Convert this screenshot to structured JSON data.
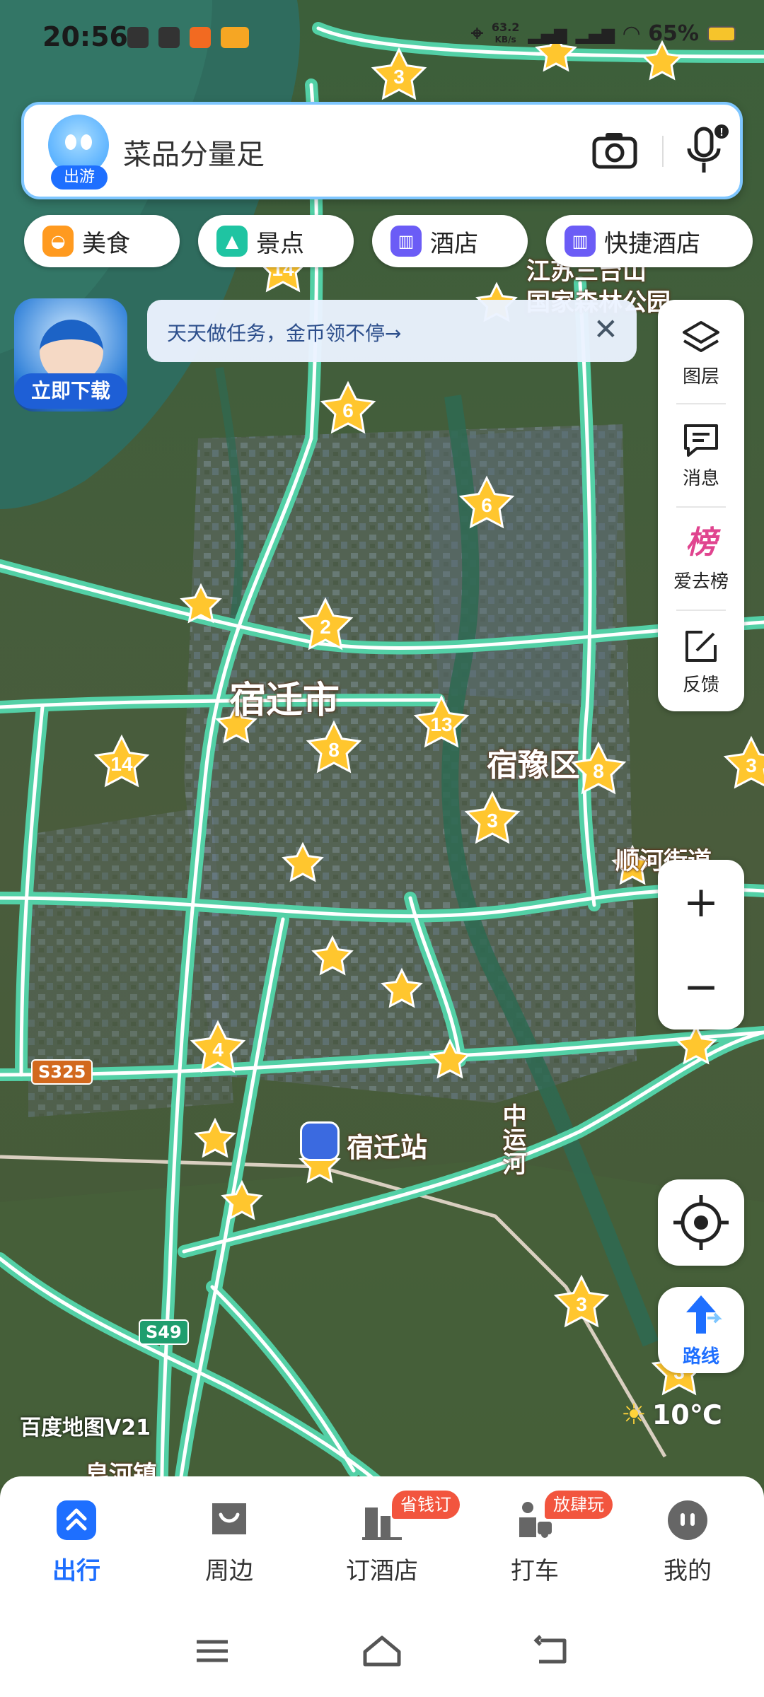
{
  "status_bar": {
    "time": "20:56",
    "net_speed": "63.2",
    "net_unit": "KB/s",
    "battery": "65%"
  },
  "search": {
    "mascot_badge": "出游",
    "query": "菜品分量足",
    "camera_icon": "camera-icon",
    "mic_icon": "microphone-icon"
  },
  "categories": [
    {
      "label": "美食",
      "icon": "food-icon",
      "color": "#ff9a1f"
    },
    {
      "label": "景点",
      "icon": "scenic-icon",
      "color": "#1fc4a2"
    },
    {
      "label": "酒店",
      "icon": "hotel-icon",
      "color": "#6b5cf6"
    },
    {
      "label": "快捷酒店",
      "icon": "budget-hotel-icon",
      "color": "#6b5cf6"
    }
  ],
  "promo": {
    "label": "立即下载",
    "tip": "天天做任务，金币领不停→"
  },
  "toolbar": [
    {
      "label": "图层",
      "icon": "layers-icon"
    },
    {
      "label": "消息",
      "icon": "message-icon"
    },
    {
      "label": "爱去榜",
      "icon": "ranking-icon",
      "glyph": "榜"
    },
    {
      "label": "反馈",
      "icon": "feedback-icon"
    }
  ],
  "zoom": {
    "in": "+",
    "out": "−"
  },
  "route_label": "路线",
  "weather": {
    "temp": "10℃"
  },
  "map": {
    "logo": "百度地图V21",
    "labels": {
      "city": "宿迁市",
      "district": "宿豫区",
      "forest_1": "江苏三台山",
      "forest_2": "国家森林公园",
      "street": "顺河街道",
      "station": "宿迁站",
      "canal": "中运河",
      "town": "皂河镇"
    },
    "roads": {
      "s325": "S325",
      "s49": "S49"
    },
    "stars": [
      "3",
      "14",
      "6",
      "6",
      "2",
      "13",
      "8",
      "8",
      "14",
      "3",
      "3",
      "4",
      "3",
      "3"
    ]
  },
  "bottom_nav": [
    {
      "label": "出行",
      "icon": "travel-icon",
      "active": true
    },
    {
      "label": "周边",
      "icon": "nearby-icon",
      "active": false
    },
    {
      "label": "订酒店",
      "icon": "book-hotel-icon",
      "active": false,
      "badge": "省钱订"
    },
    {
      "label": "打车",
      "icon": "taxi-icon",
      "active": false,
      "badge": "放肆玩"
    },
    {
      "label": "我的",
      "icon": "profile-icon",
      "active": false
    }
  ]
}
